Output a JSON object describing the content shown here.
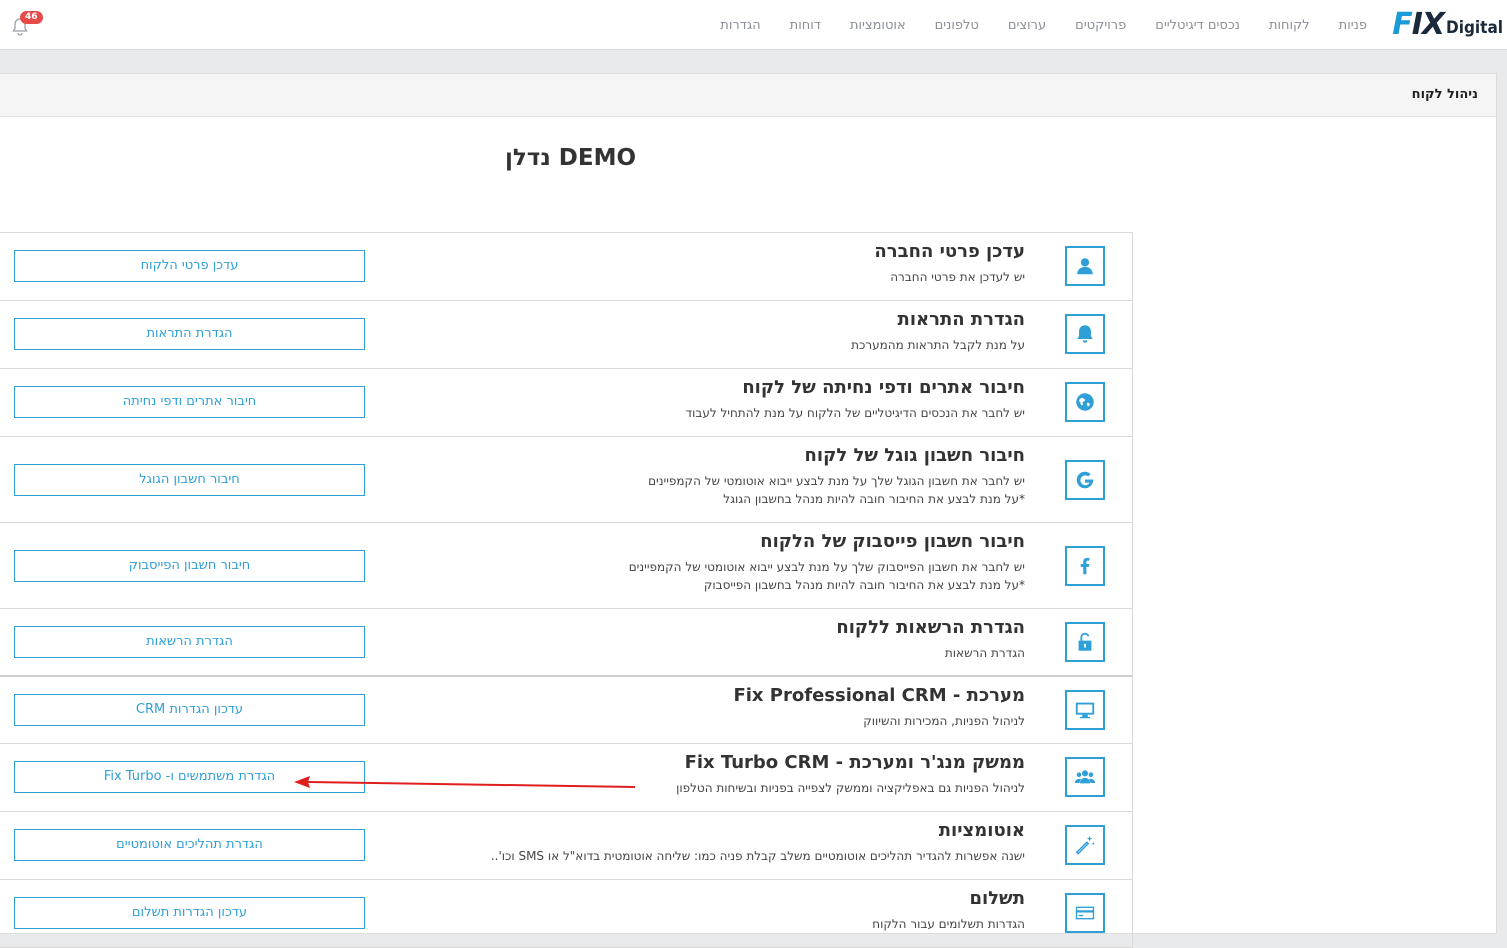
{
  "topbar": {
    "logo_fix": "FIX",
    "logo_digital": "Digital",
    "nav": [
      "פניות",
      "לקוחות",
      "נכסים דיגיטליים",
      "פרויקטים",
      "ערוצים",
      "טלפונים",
      "אוטומציות",
      "דוחות",
      "הגדרות"
    ],
    "notification_count": "46"
  },
  "panel": {
    "title": "ניהול לקוח",
    "client_name": "DEMO נדלן"
  },
  "rows": [
    {
      "icon": "user-icon",
      "title": "עדכן פרטי החברה",
      "desc": [
        "יש לעדכן את פרטי החברה"
      ],
      "button": "עדכן פרטי הלקוח"
    },
    {
      "icon": "bell-icon",
      "title": "הגדרת התראות",
      "desc": [
        "על מנת לקבל התראות מהמערכת"
      ],
      "button": "הגדרת התראות"
    },
    {
      "icon": "globe-icon",
      "title": "חיבור אתרים ודפי נחיתה של לקוח",
      "desc": [
        "יש לחבר את הנכסים הדיגיטליים של הלקוח על מנת להתחיל לעבוד"
      ],
      "button": "חיבור אתרים ודפי נחיתה"
    },
    {
      "icon": "google-icon",
      "title": "חיבור חשבון גוגל של לקוח",
      "desc": [
        "יש לחבר את חשבון הגוגל שלך על מנת לבצע ייבוא אוטומטי של הקמפיינים",
        "*על מנת לבצע את החיבור חובה להיות מנהל בחשבון הגוגל"
      ],
      "button": "חיבור חשבון הגוגל"
    },
    {
      "icon": "facebook-icon",
      "title": "חיבור חשבון פייסבוק של הלקוח",
      "desc": [
        "יש לחבר את חשבון הפייסבוק שלך על מנת לבצע ייבוא אוטומטי של הקמפיינים",
        "*על מנת לבצע את החיבור חובה להיות מנהל בחשבון הפייסבוק"
      ],
      "button": "חיבור חשבון הפייסבוק"
    },
    {
      "icon": "unlock-icon",
      "title": "הגדרת הרשאות ללקוח",
      "desc": [
        "הגדרת הרשאות"
      ],
      "button": "הגדרת הרשאות"
    },
    {
      "icon": "monitor-icon",
      "title": "מערכת - Fix Professional CRM",
      "desc": [
        "לניהול הפניות, המכירות והשיווק"
      ],
      "button": "עדכון הגדרות CRM"
    },
    {
      "icon": "users-icon",
      "title": "ממשק מנג'ר ומערכת - Fix Turbo CRM",
      "desc": [
        "לניהול הפניות גם באפליקציה וממשק לצפייה בפניות ובשיחות הטלפון"
      ],
      "button": "הגדרת משתמשים ו- Fix Turbo"
    },
    {
      "icon": "magic-wand-icon",
      "title": "אוטומציות",
      "desc": [
        "ישנה אפשרות להגדיר תהליכים אוטומטיים משלב קבלת פניה כמו: שליחה אוטומטית בדוא\"ל או SMS וכו'.."
      ],
      "button": "הגדרת תהליכים אוטומטיים"
    },
    {
      "icon": "credit-card-icon",
      "title": "תשלום",
      "desc": [
        "הגדרות תשלומים עבור הלקוח"
      ],
      "button": "עדכון הגדרות תשלום"
    }
  ],
  "colors": {
    "accent": "#2f9fd8",
    "annotation_arrow": "#e01e1e",
    "badge": "#e84a4a"
  }
}
